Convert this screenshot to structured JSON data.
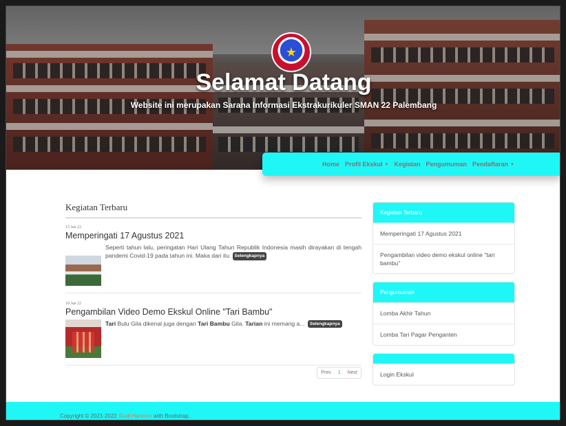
{
  "hero": {
    "title": "Selamat Datang",
    "subtitle": "Website ini merupakan Sarana Informasi Ekstrakurikuler SMAN 22 Palembang"
  },
  "nav": {
    "home": "Home",
    "profil": "Profil Ekskul",
    "kegiatan": "Kegiatan",
    "pengumuman": "Pengumuman",
    "pendaftaran": "Pendaftaran"
  },
  "main": {
    "section_title": "Kegiatan Terbaru",
    "posts": [
      {
        "date": "15 Jan 22",
        "title": "Memperingati 17 Agustus 2021",
        "text": "Seperti tahun lalu, peringatan Hari Ulang Tahun Republik Indonesia masih dirayakan di tengah pandemi Covid-19 pada tahun ini. Maka dari itu",
        "more": "Selengkapnya"
      },
      {
        "date": "18 Jan 22",
        "title": "Pengambilan Video Demo Ekskul Online \"Tari Bambu\"",
        "text_parts": [
          "Tari",
          " Bulu Gila dikenal juga dengan ",
          "Tari Bambu",
          " Gila. ",
          "Tarian",
          " ini memang a..."
        ],
        "more": "Selengkapnya"
      }
    ],
    "pager": {
      "prev": "Prev",
      "page": "1",
      "next": "Next"
    }
  },
  "sidebar": {
    "cards": [
      {
        "title": "Kegiatan Terbaru",
        "items": [
          "Memperingati 17 Agustus 2021",
          "Pengambilan video demo ekskul online \"tari bambu\""
        ]
      },
      {
        "title": "Pengumuman",
        "items": [
          "Lomba Akhir Tahun",
          "Lomba Tari Pagar Penganten"
        ]
      },
      {
        "title": "",
        "items": [
          "Login Ekskul"
        ]
      }
    ]
  },
  "footer": {
    "prefix": "Copyright © 2021-2022",
    "author": "Rudi Hartono",
    "suffix": "with Bootstrap."
  },
  "colors": {
    "accent": "#1ff7f7",
    "link": "#ff6b3d"
  }
}
